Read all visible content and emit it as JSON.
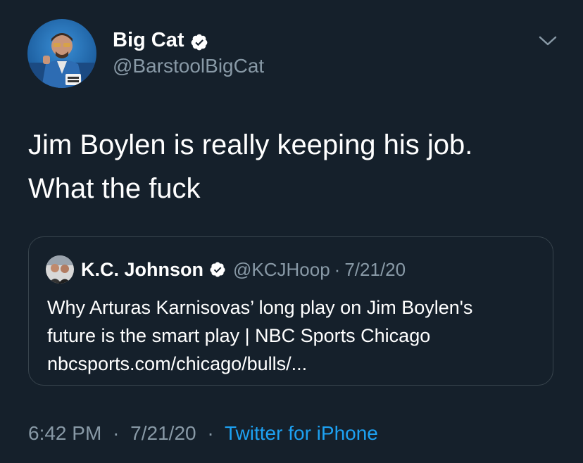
{
  "author": {
    "display_name": "Big Cat",
    "handle": "@BarstoolBigCat",
    "verified": true
  },
  "tweet": {
    "lines": [
      "Jim Boylen is really keeping his job.",
      "What the fuck"
    ]
  },
  "quoted_tweet": {
    "display_name": "K.C. Johnson",
    "handle": "@KCJHoop",
    "separator": "·",
    "date": "7/21/20",
    "body_lines": [
      "Why Arturas Karnisovas’ long play on Jim Boylen's",
      "future is the smart play | NBC Sports Chicago",
      "nbcsports.com/chicago/bulls/..."
    ]
  },
  "meta": {
    "time": "6:42 PM",
    "separator": "·",
    "date": "7/21/20",
    "source": "Twitter for iPhone"
  },
  "colors": {
    "background": "#15202b",
    "secondary_text": "#8899a6",
    "accent": "#1da1f2",
    "border": "#38444d"
  },
  "icons": {
    "verified": "verified-badge-icon",
    "caret": "chevron-down-icon"
  }
}
